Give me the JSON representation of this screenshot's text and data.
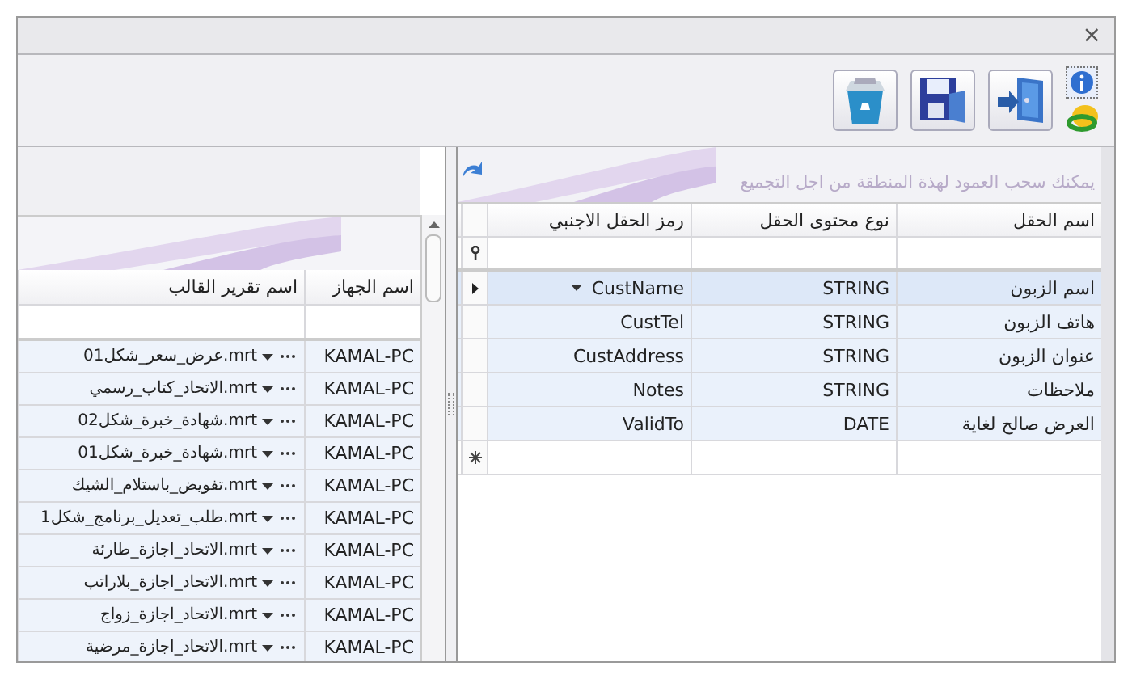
{
  "window": {
    "close_glyph": "×"
  },
  "fields_grid": {
    "group_hint": "يمكنك سحب العمود لهذة المنطقة من اجل التجميع",
    "columns": [
      "اسم الحقل",
      "نوع محتوى الحقل",
      "رمز الحقل الاجنبي"
    ],
    "rows": [
      {
        "name": "اسم الزبون",
        "type": "STRING",
        "code": "CustName",
        "selected": true
      },
      {
        "name": "هاتف الزبون",
        "type": "STRING",
        "code": "CustTel",
        "selected": false
      },
      {
        "name": "عنوان الزبون",
        "type": "STRING",
        "code": "CustAddress",
        "selected": false
      },
      {
        "name": "ملاحظات",
        "type": "STRING",
        "code": "Notes",
        "selected": false
      },
      {
        "name": "العرض صالح لغاية",
        "type": "DATE",
        "code": "ValidTo",
        "selected": false
      }
    ]
  },
  "templates_grid": {
    "columns": [
      "اسم الجهاز",
      "اسم تقرير القالب"
    ],
    "rows": [
      {
        "device": "KAMAL-PC",
        "template": "عرض_سعر_شكل01.mrt"
      },
      {
        "device": "KAMAL-PC",
        "template": "الاتحاد_كتاب_رسمي.mrt"
      },
      {
        "device": "KAMAL-PC",
        "template": "شهادة_خبرة_شكل02.mrt"
      },
      {
        "device": "KAMAL-PC",
        "template": "شهادة_خبرة_شكل01.mrt"
      },
      {
        "device": "KAMAL-PC",
        "template": "تفويض_باستلام_الشيك.mrt"
      },
      {
        "device": "KAMAL-PC",
        "template": "طلب_تعديل_برنامج_شكل1.mrt"
      },
      {
        "device": "KAMAL-PC",
        "template": "الاتحاد_اجازة_طارئة.mrt"
      },
      {
        "device": "KAMAL-PC",
        "template": "الاتحاد_اجازة_بلاراتب.mrt"
      },
      {
        "device": "KAMAL-PC",
        "template": "الاتحاد_اجازة_زواج.mrt"
      },
      {
        "device": "KAMAL-PC",
        "template": "الاتحاد_اجازة_مرضية.mrt"
      }
    ]
  }
}
